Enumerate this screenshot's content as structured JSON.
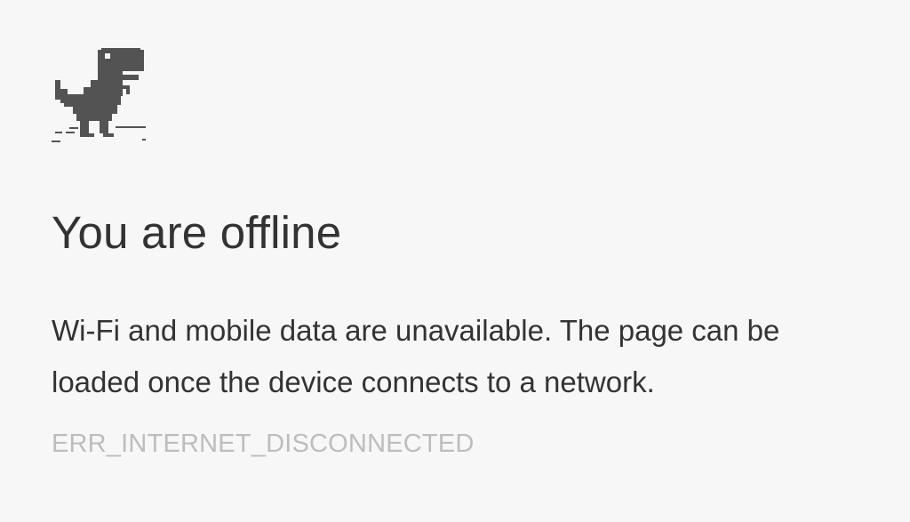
{
  "offline_page": {
    "icon": "offline-dino-icon",
    "title": "You are offline",
    "message": "Wi-Fi and mobile data are unavailable. The page can be loaded once the device connects to a network.",
    "error_code": "ERR_INTERNET_DISCONNECTED",
    "colors": {
      "background": "#f7f7f7",
      "text": "#333333",
      "error_code": "#bdbdbd",
      "dino": "#535353"
    }
  }
}
